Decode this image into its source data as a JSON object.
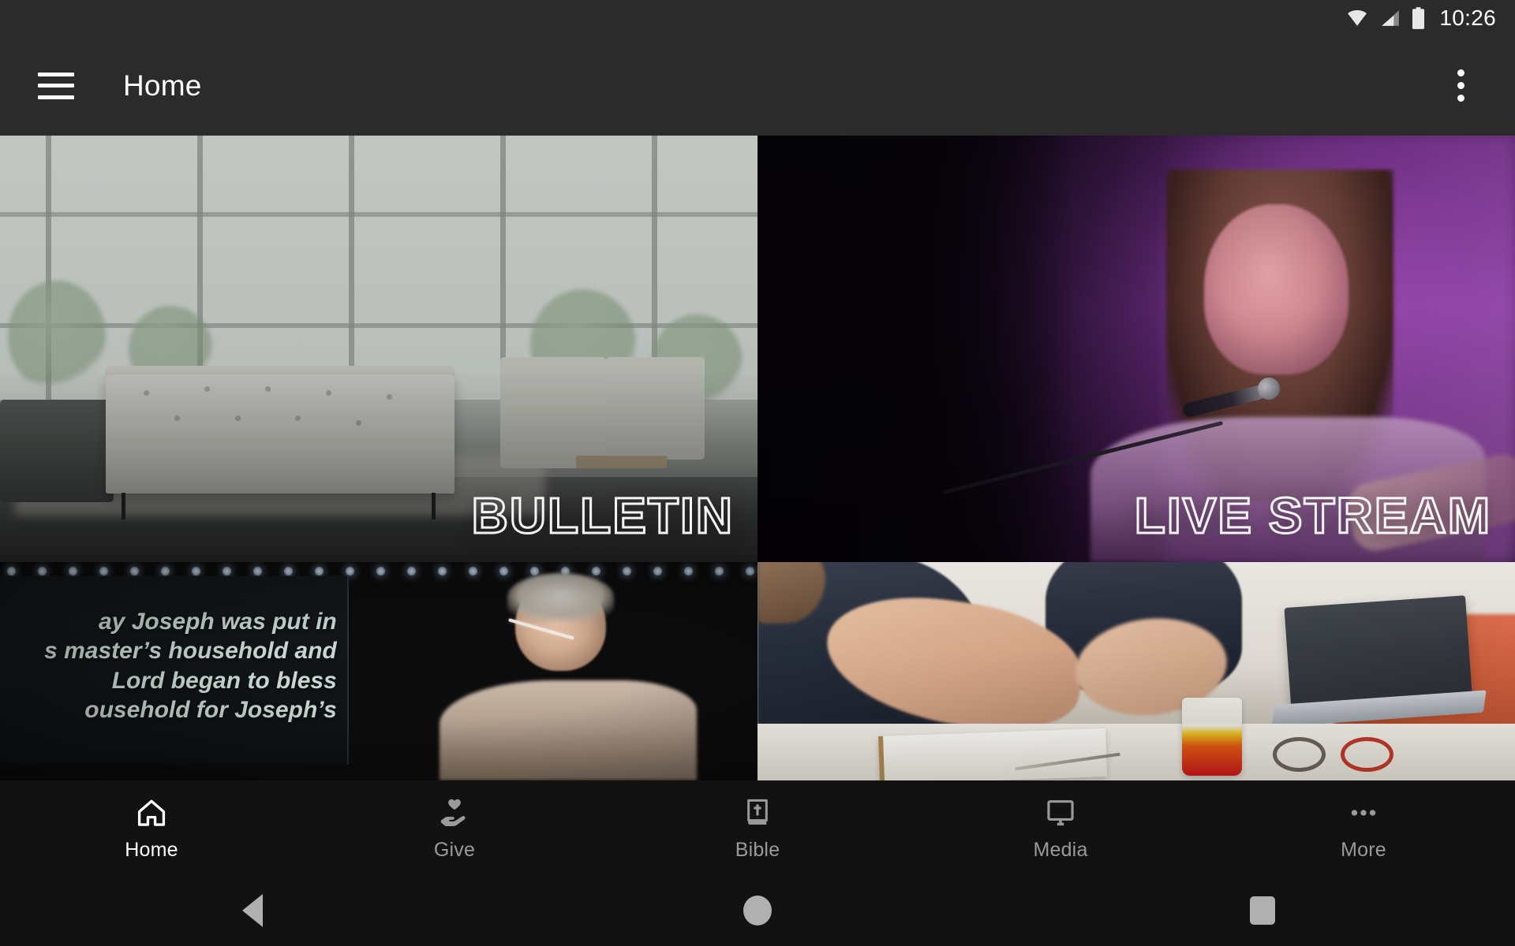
{
  "status_bar": {
    "time": "10:26",
    "icons": [
      "wifi-icon",
      "cellular-signal-icon",
      "battery-icon"
    ]
  },
  "app_bar": {
    "menu_icon": "hamburger-menu-icon",
    "title": "Home",
    "overflow_icon": "more-vertical-icon"
  },
  "tiles": [
    {
      "id": "bulletin",
      "label": "BULLETIN",
      "description": "Bright church lobby with white tufted sofa and chairs by large windows"
    },
    {
      "id": "live-stream",
      "label": "LIVE STREAM",
      "description": "Female worship singer at microphone under purple stage lighting"
    },
    {
      "id": "sermon",
      "label": "",
      "description": "Pastor on stage with sermon slide showing scripture text",
      "slide_text": [
        "ay Joseph was put in",
        "s master’s household and",
        "Lord began to bless",
        "ousehold for Joseph’s"
      ]
    },
    {
      "id": "groups",
      "label": "",
      "description": "People gathered around a table with notebooks, drinks and a laptop"
    }
  ],
  "bottom_nav": {
    "items": [
      {
        "label": "Home",
        "icon": "home-icon",
        "active": true
      },
      {
        "label": "Give",
        "icon": "giving-hand-heart-icon",
        "active": false
      },
      {
        "label": "Bible",
        "icon": "bible-book-icon",
        "active": false
      },
      {
        "label": "Media",
        "icon": "monitor-icon",
        "active": false
      },
      {
        "label": "More",
        "icon": "more-horizontal-icon",
        "active": false
      }
    ]
  },
  "system_nav": {
    "back": "back-triangle-icon",
    "home": "home-circle-icon",
    "recents": "recents-square-icon"
  },
  "colors": {
    "app_bar_bg": "#2b2b2b",
    "nav_bg": "#121212",
    "active_text": "#ffffff",
    "inactive_text": "#9a9a9a",
    "accent_purple": "#8a4a9e"
  }
}
